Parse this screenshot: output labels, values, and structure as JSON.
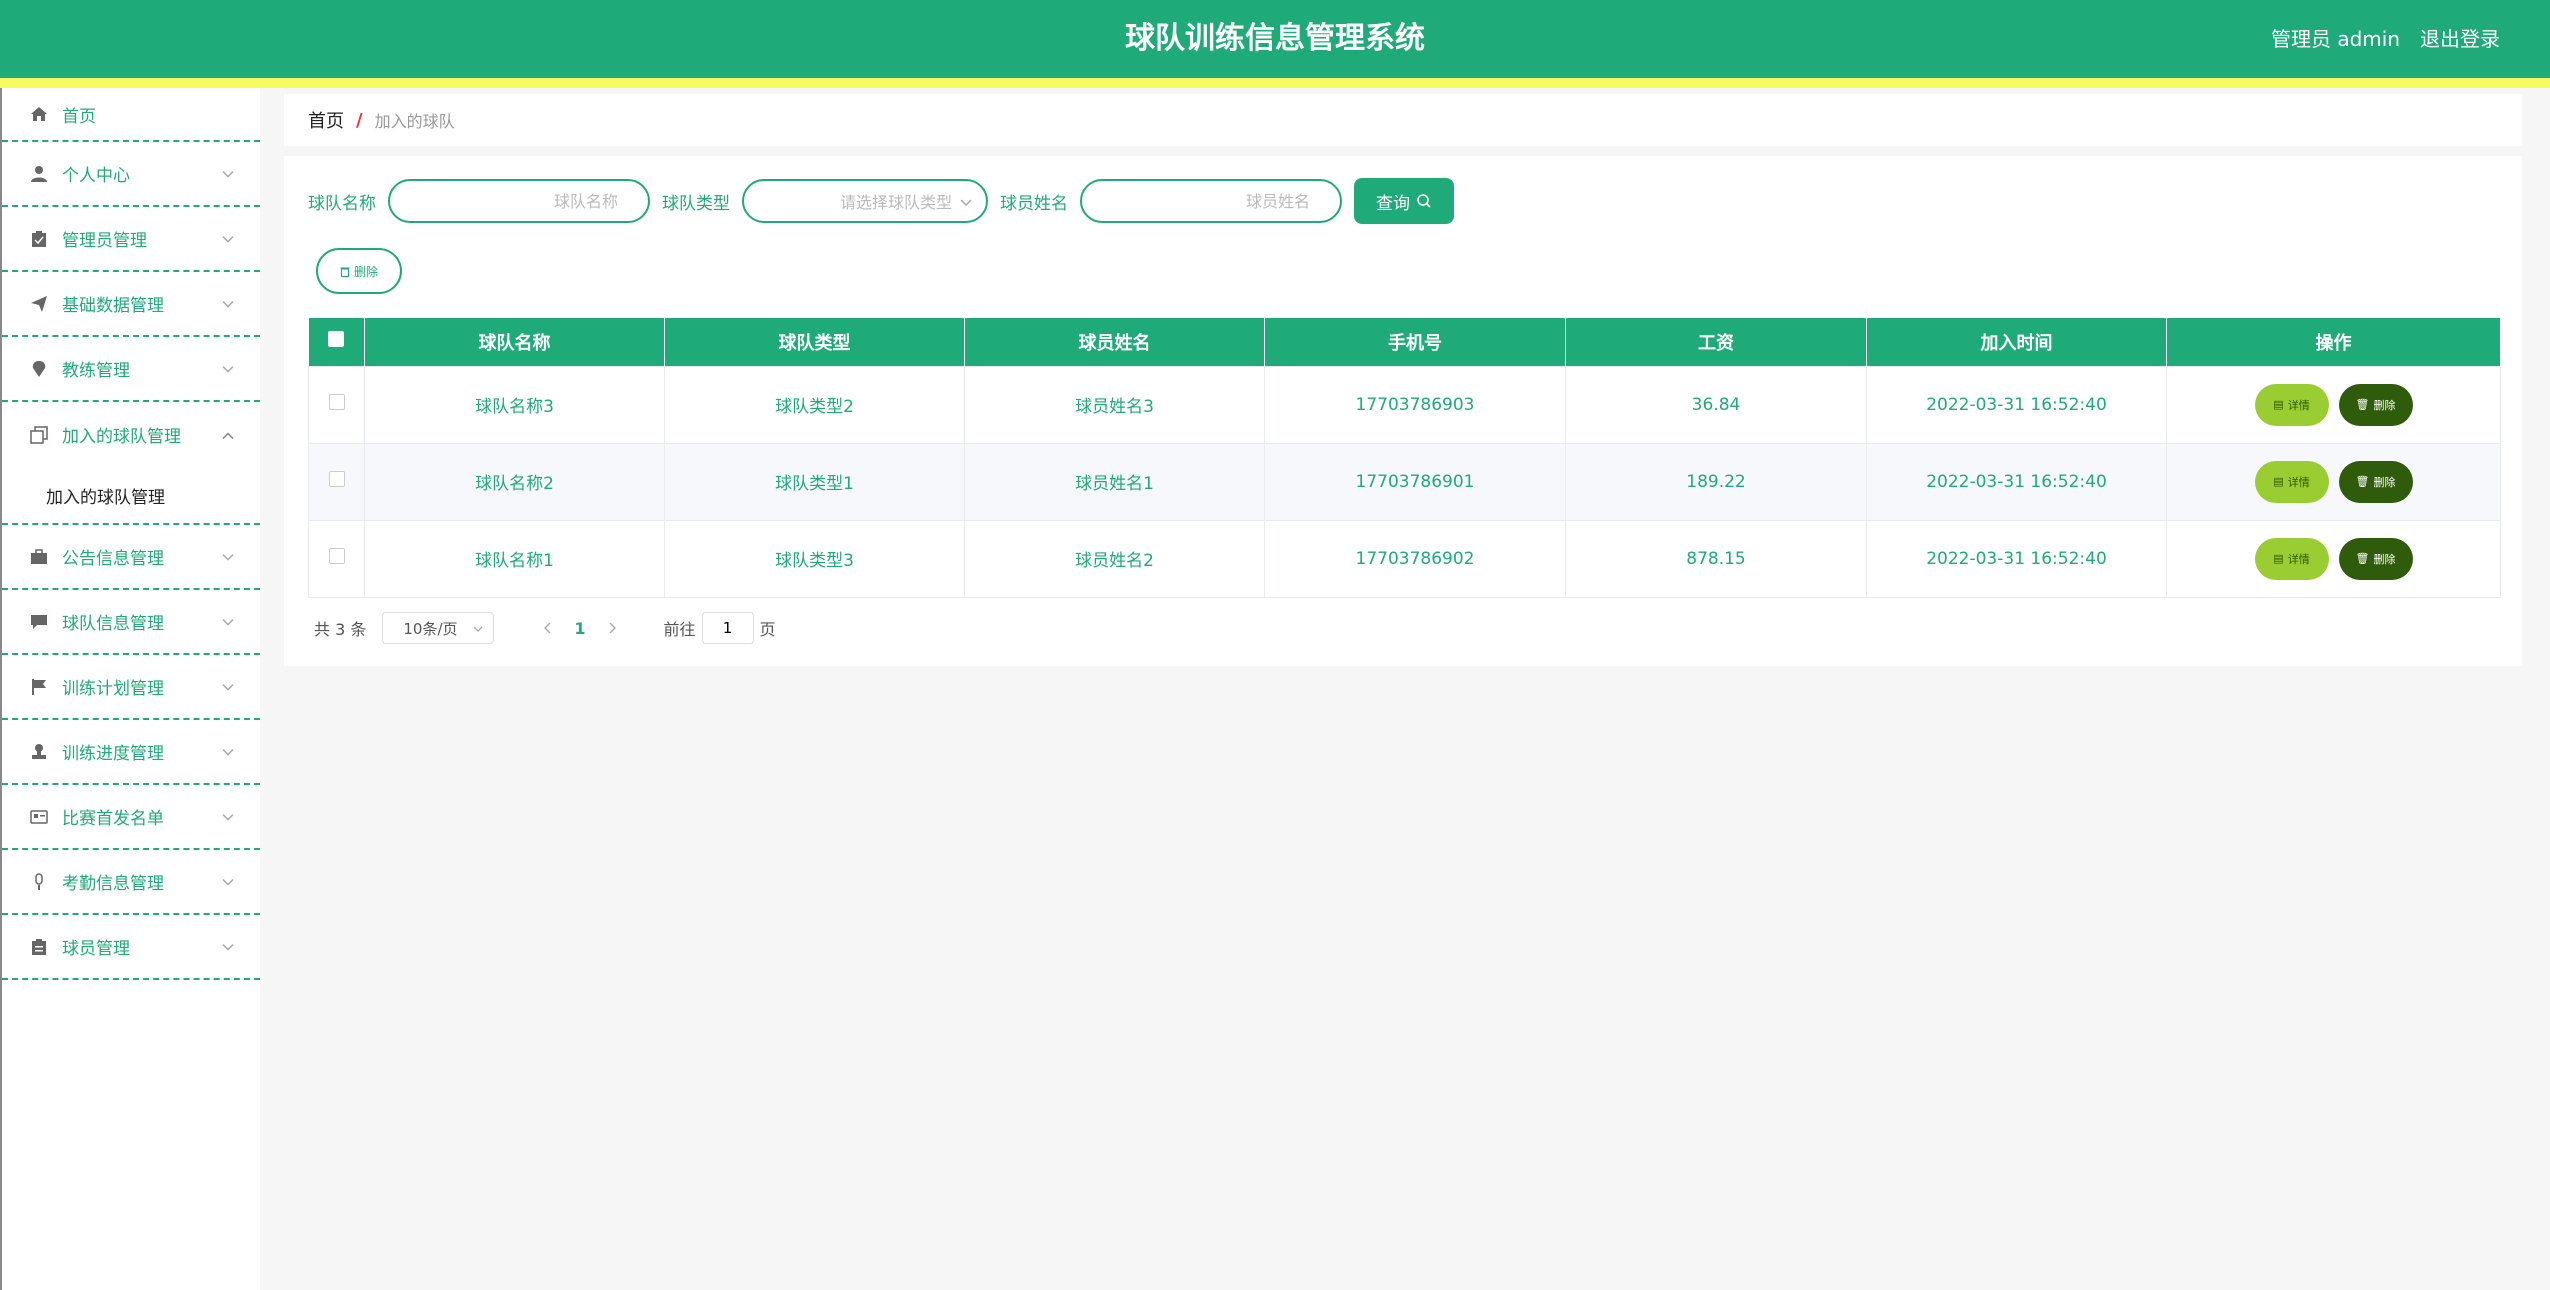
{
  "header": {
    "title": "球队训练信息管理系统",
    "user": "管理员 admin",
    "logout": "退出登录"
  },
  "sidebar": {
    "items": [
      {
        "label": "首页",
        "icon": "home-icon"
      },
      {
        "label": "个人中心",
        "icon": "user-icon"
      },
      {
        "label": "管理员管理",
        "icon": "clipboard-icon"
      },
      {
        "label": "基础数据管理",
        "icon": "send-icon"
      },
      {
        "label": "教练管理",
        "icon": "location-icon"
      },
      {
        "label": "加入的球队管理",
        "icon": "copy-icon",
        "expanded": true,
        "sub": "加入的球队管理"
      },
      {
        "label": "公告信息管理",
        "icon": "briefcase-icon"
      },
      {
        "label": "球队信息管理",
        "icon": "chat-icon"
      },
      {
        "label": "训练计划管理",
        "icon": "flag-icon"
      },
      {
        "label": "训练进度管理",
        "icon": "stamp-icon"
      },
      {
        "label": "比赛首发名单",
        "icon": "id-card-icon"
      },
      {
        "label": "考勤信息管理",
        "icon": "mic-icon"
      },
      {
        "label": "球员管理",
        "icon": "clipboard-icon"
      }
    ]
  },
  "breadcrumb": {
    "home": "首页",
    "sep": "/",
    "current": "加入的球队"
  },
  "search": {
    "team_name_label": "球队名称",
    "team_name_placeholder": "球队名称",
    "team_type_label": "球队类型",
    "team_type_placeholder": "请选择球队类型",
    "player_name_label": "球员姓名",
    "player_name_placeholder": "球员姓名",
    "query_label": "查询"
  },
  "toolbar": {
    "delete_label": "删除"
  },
  "table": {
    "columns": [
      "球队名称",
      "球队类型",
      "球员姓名",
      "手机号",
      "工资",
      "加入时间",
      "操作"
    ],
    "rows": [
      {
        "team": "球队名称3",
        "type": "球队类型2",
        "player": "球员姓名3",
        "phone": "17703786903",
        "salary": "36.84",
        "time": "2022-03-31 16:52:40"
      },
      {
        "team": "球队名称2",
        "type": "球队类型1",
        "player": "球员姓名1",
        "phone": "17703786901",
        "salary": "189.22",
        "time": "2022-03-31 16:52:40"
      },
      {
        "team": "球队名称1",
        "type": "球队类型3",
        "player": "球员姓名2",
        "phone": "17703786902",
        "salary": "878.15",
        "time": "2022-03-31 16:52:40"
      }
    ],
    "detail_label": "详情",
    "delete_label": "删除"
  },
  "pager": {
    "total": "共 3 条",
    "page_size": "10条/页",
    "current_page": "1",
    "goto_prefix": "前往",
    "goto_value": "1",
    "goto_suffix": "页"
  },
  "colors": {
    "primary": "#1fab79",
    "accent_strip": "#f6fb61",
    "detail_button": "#9acd32",
    "delete_button": "#2f5c0a"
  }
}
